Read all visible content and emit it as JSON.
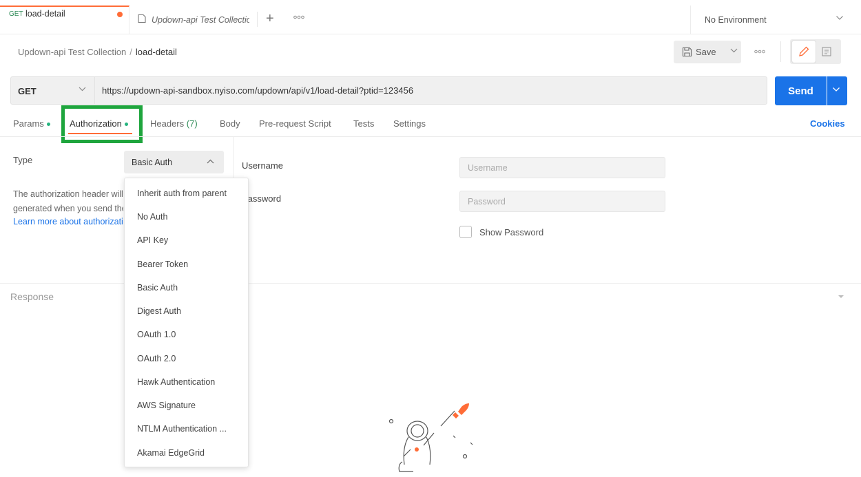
{
  "tabs": {
    "active": {
      "method": "GET",
      "title": "load-detail"
    },
    "second": {
      "title": "Updown-api Test Collection"
    },
    "environment": "No Environment"
  },
  "breadcrumb": {
    "collection": "Updown-api Test Collection",
    "separator": "/",
    "request": "load-detail"
  },
  "toolbar": {
    "save_label": "Save"
  },
  "request": {
    "method": "GET",
    "url": "https://updown-api-sandbox.nyiso.com/updown/api/v1/load-detail?ptid=123456",
    "send_label": "Send"
  },
  "request_tabs": {
    "params": "Params",
    "authorization": "Authorization",
    "headers": "Headers",
    "headers_count": "(7)",
    "body": "Body",
    "prerequest": "Pre-request Script",
    "tests": "Tests",
    "settings": "Settings",
    "cookies": "Cookies"
  },
  "auth": {
    "type_label": "Type",
    "type_value": "Basic Auth",
    "description_line1": "The authorization header will be automatically",
    "description_line2": "generated when you send the request.",
    "learn_more": "Learn more about authorization",
    "username_label": "Username",
    "username_placeholder": "Username",
    "password_label": "Password",
    "password_placeholder": "Password",
    "show_password": "Show Password"
  },
  "dropdown": {
    "items": [
      "Inherit auth from parent",
      "No Auth",
      "API Key",
      "Bearer Token",
      "Basic Auth",
      "Digest Auth",
      "OAuth 1.0",
      "OAuth 2.0",
      "Hawk Authentication",
      "AWS Signature",
      "NTLM Authentication ...",
      "Akamai EdgeGrid"
    ]
  },
  "response": {
    "label": "Response"
  },
  "colors": {
    "accent": "#ff6c37",
    "primary": "#1a73e8",
    "highlight": "#1ea53d",
    "status_dot": "#26b47f"
  }
}
